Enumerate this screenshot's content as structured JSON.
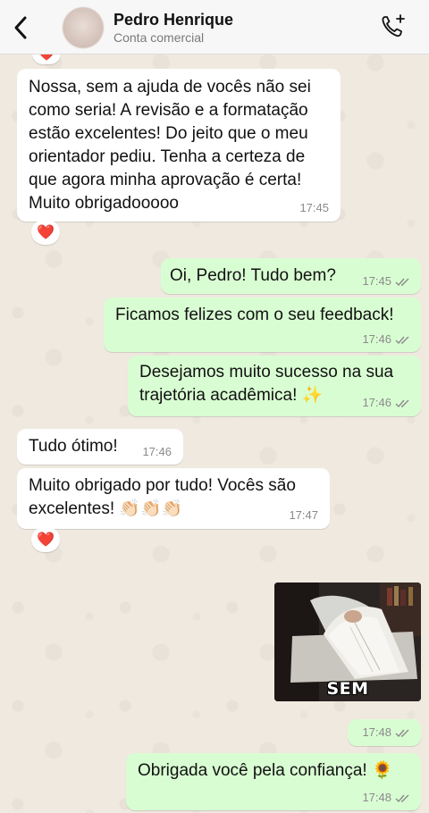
{
  "header": {
    "contact_name": "Pedro Henrique",
    "contact_subtitle": "Conta comercial",
    "back_icon": "chevron-left-icon",
    "call_icon": "phone-add-icon"
  },
  "colors": {
    "incoming_bubble": "#ffffff",
    "outgoing_bubble": "#d9fdd3",
    "read_ticks": "#8a8a8a",
    "heart": "#e0245e"
  },
  "messages": [
    {
      "direction": "in",
      "text": "Nossa, sem a ajuda de vocês não sei\ncomo seria! A revisão e a formatação\nestão excelentes! Do jeito que o meu\norientador pediu. Tenha a certeza de\nque agora minha aprovação é certa!\nMuito obrigadooooo",
      "time": "17:45",
      "reaction": "❤️"
    },
    {
      "direction": "out",
      "text": "Oi, Pedro! Tudo bem?",
      "time": "17:45"
    },
    {
      "direction": "out",
      "text": "Ficamos felizes com o seu feedback!",
      "time": "17:46"
    },
    {
      "direction": "out",
      "text": "Desejamos muito sucesso na sua\ntrajetória acadêmica! ✨",
      "time": "17:46"
    },
    {
      "direction": "in",
      "text": "Tudo ótimo!",
      "time": "17:46"
    },
    {
      "direction": "in",
      "text": "Muito obrigado por tudo! Vocês são\nexcelentes! 👏🏻👏🏻👏🏻",
      "time": "17:47",
      "reaction": "❤️"
    },
    {
      "direction": "out",
      "type": "gif",
      "caption": "SEM PALAVRAS",
      "time": "17:48"
    },
    {
      "direction": "out",
      "text": "Obrigada você pela confiança! 🌻",
      "time": "17:48"
    }
  ],
  "top_reaction": "❤️"
}
